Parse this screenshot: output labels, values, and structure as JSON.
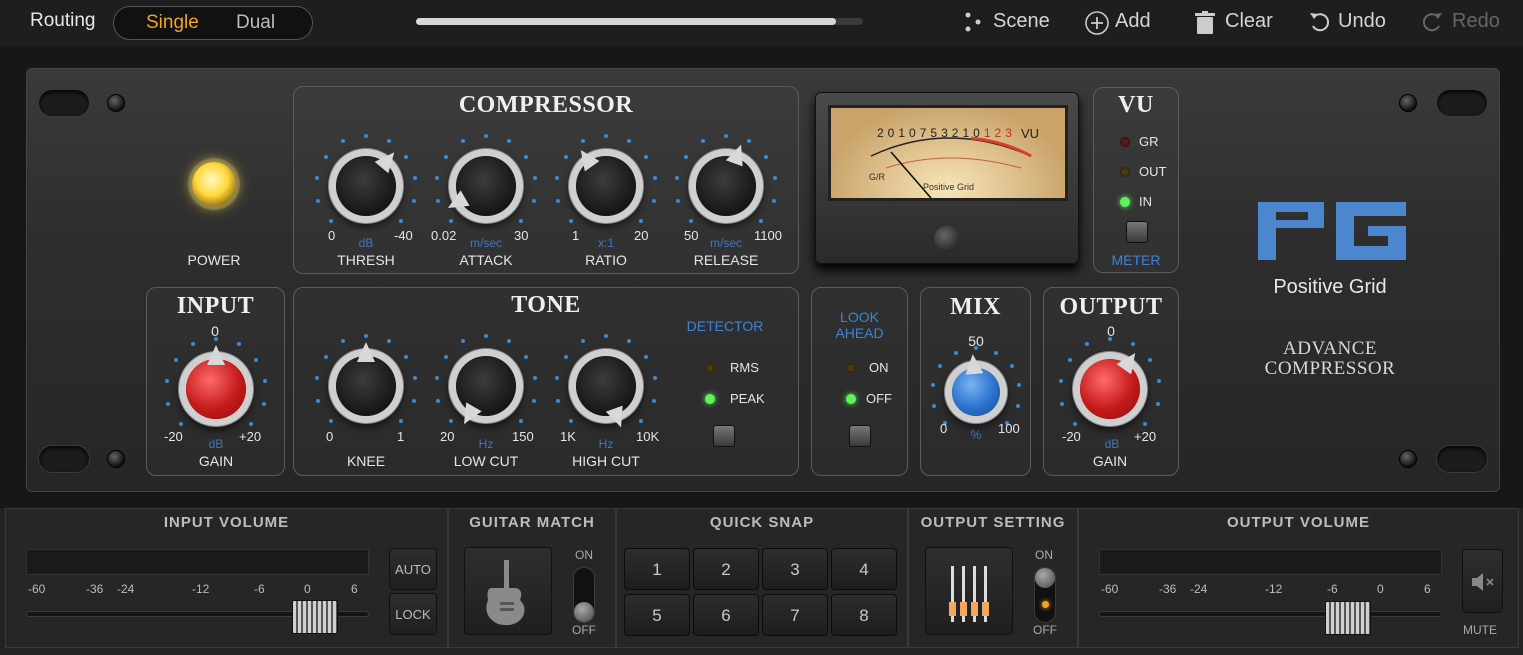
{
  "topbar": {
    "routing_label": "Routing",
    "routing_options": [
      "Single",
      "Dual"
    ],
    "routing_selected": "Single",
    "progress_fraction": 0.94,
    "scene_label": "Scene",
    "add_label": "Add",
    "clear_label": "Clear",
    "undo_label": "Undo",
    "redo_label": "Redo"
  },
  "plugin": {
    "power_label": "POWER",
    "compressor": {
      "title": "COMPRESSOR",
      "knobs": [
        {
          "label": "THRESH",
          "min": "0",
          "max": "-40",
          "unit": "dB"
        },
        {
          "label": "ATTACK",
          "min": "0.02",
          "max": "30",
          "unit": "m/sec"
        },
        {
          "label": "RATIO",
          "min": "1",
          "max": "20",
          "unit": "x:1"
        },
        {
          "label": "RELEASE",
          "min": "50",
          "max": "1100",
          "unit": "m/sec"
        }
      ]
    },
    "vu_meter": {
      "scale_top": [
        "20",
        "10",
        "7",
        "5",
        "3",
        "2",
        "1",
        "0",
        "1",
        "2",
        "3"
      ],
      "scale_label": "VU",
      "gr_label": "G/R",
      "brand": "Positive Grid"
    },
    "vu_panel": {
      "title": "VU",
      "leds": [
        "GR",
        "OUT",
        "IN"
      ],
      "active_led": "IN",
      "meter_label": "METER"
    },
    "input": {
      "title": "INPUT",
      "top": "0",
      "min": "-20",
      "max": "+20",
      "unit": "dB",
      "label": "GAIN"
    },
    "tone": {
      "title": "TONE",
      "knobs": [
        {
          "label": "KNEE",
          "min": "0",
          "max": "1",
          "unit": ""
        },
        {
          "label": "LOW CUT",
          "min": "20",
          "max": "150",
          "unit": "Hz"
        },
        {
          "label": "HIGH CUT",
          "min": "1K",
          "max": "10K",
          "unit": "Hz"
        }
      ],
      "detector_title": "DETECTOR",
      "detector_options": [
        "RMS",
        "PEAK"
      ],
      "detector_active": "PEAK"
    },
    "lookahead": {
      "title_line1": "LOOK",
      "title_line2": "AHEAD",
      "options": [
        "ON",
        "OFF"
      ],
      "active": "OFF"
    },
    "mix": {
      "title": "MIX",
      "top": "50",
      "min": "0",
      "max": "100",
      "unit": "%"
    },
    "output": {
      "title": "OUTPUT",
      "top": "0",
      "min": "-20",
      "max": "+20",
      "unit": "dB",
      "label": "GAIN"
    },
    "logo_text": "Positive Grid",
    "product_line1": "ADVANCE",
    "product_line2": "COMPRESSOR"
  },
  "bottom": {
    "input_volume": {
      "title": "INPUT VOLUME",
      "scale": [
        "-60",
        "-36",
        "-24",
        "-12",
        "-6",
        "0",
        "6"
      ],
      "auto_label": "AUTO",
      "lock_label": "LOCK"
    },
    "guitar_match": {
      "title": "GUITAR MATCH",
      "on_label": "ON",
      "off_label": "OFF"
    },
    "quick_snap": {
      "title": "QUICK SNAP",
      "slots": [
        "1",
        "2",
        "3",
        "4",
        "5",
        "6",
        "7",
        "8"
      ]
    },
    "output_setting": {
      "title": "OUTPUT SETTING",
      "on_label": "ON",
      "off_label": "OFF"
    },
    "output_volume": {
      "title": "OUTPUT VOLUME",
      "scale": [
        "-60",
        "-36",
        "-24",
        "-12",
        "-6",
        "0",
        "6"
      ],
      "mute_label": "MUTE"
    }
  }
}
